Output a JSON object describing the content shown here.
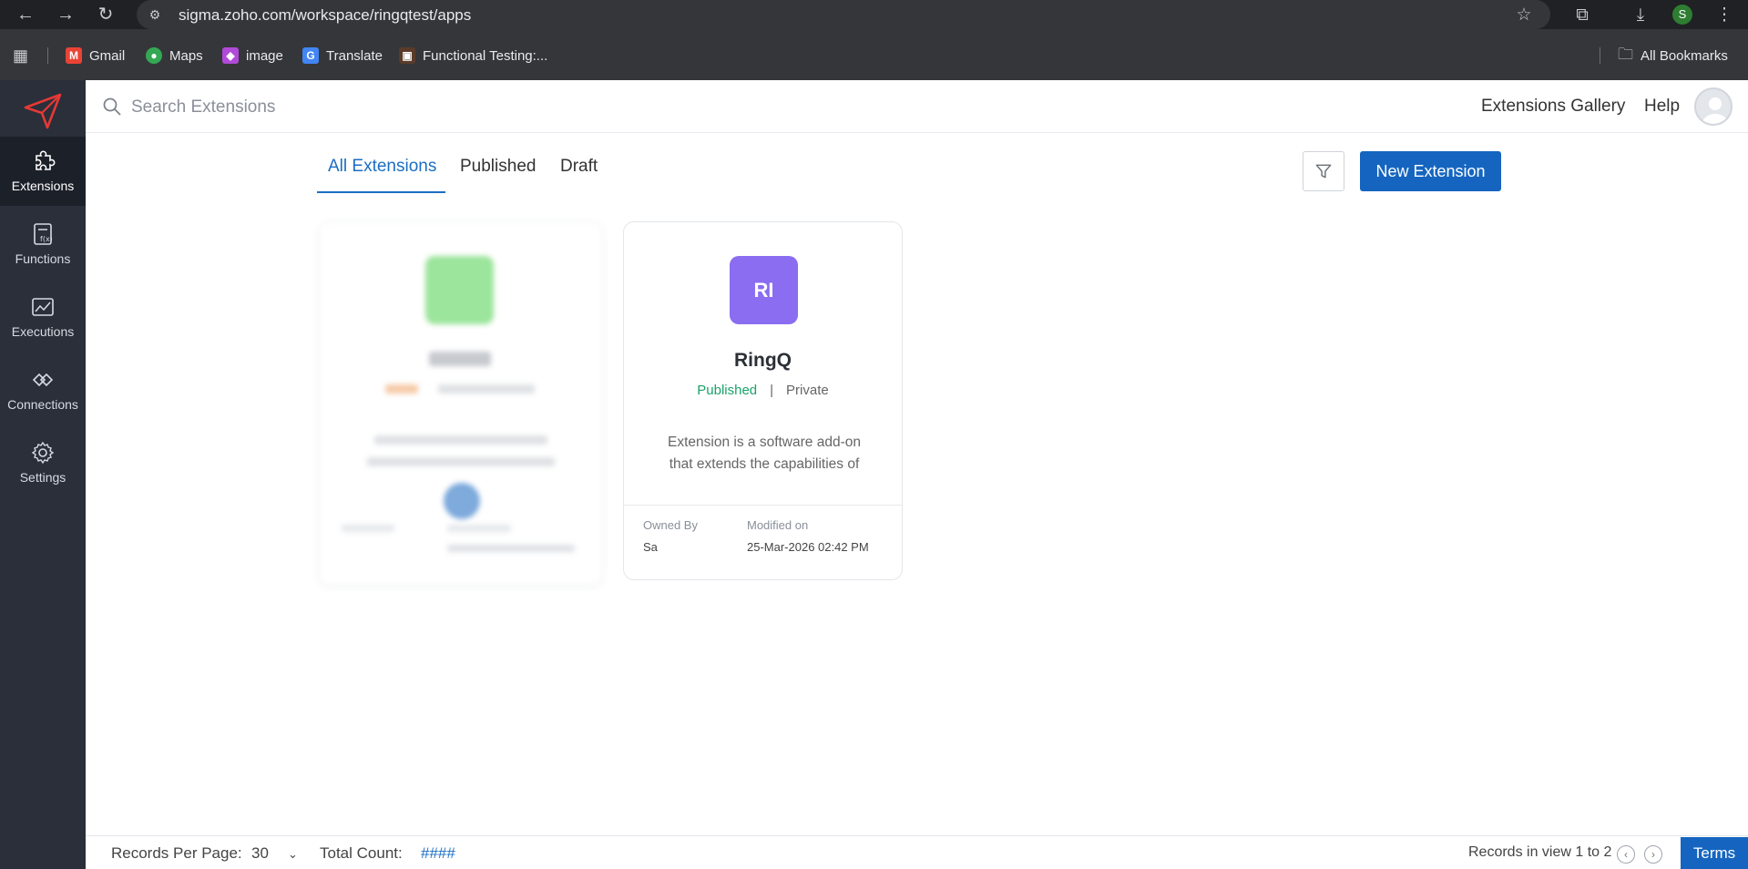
{
  "browser": {
    "url": "sigma.zoho.com/workspace/ringqtest/apps",
    "profile_initial": "S",
    "bookmarks": [
      {
        "label": "Gmail"
      },
      {
        "label": "Maps"
      },
      {
        "label": "image"
      },
      {
        "label": "Translate"
      },
      {
        "label": "Functional Testing:..."
      }
    ],
    "all_bookmarks": "All Bookmarks"
  },
  "sidebar": {
    "items": [
      {
        "label": "Extensions",
        "icon": "puzzle-icon"
      },
      {
        "label": "Functions",
        "icon": "function-icon"
      },
      {
        "label": "Executions",
        "icon": "executions-icon"
      },
      {
        "label": "Connections",
        "icon": "connections-icon"
      },
      {
        "label": "Settings",
        "icon": "gear-icon"
      }
    ]
  },
  "header": {
    "search_placeholder": "Search Extensions",
    "gallery_label": "Extensions Gallery",
    "help_label": "Help"
  },
  "tabs": [
    {
      "label": "All Extensions"
    },
    {
      "label": "Published"
    },
    {
      "label": "Draft"
    }
  ],
  "actions": {
    "new_extension": "New Extension"
  },
  "cards": [
    {
      "initials": "RI",
      "name": "RingQ",
      "status": "Published",
      "visibility": "Private",
      "description": "Extension is a software add-on that extends the capabilities of",
      "owned_by_label": "Owned By",
      "owned_by": "Sa",
      "modified_label": "Modified on",
      "modified": "25-Mar-2026 02:42 PM",
      "avatar_color": "#8a6df0"
    }
  ],
  "footer": {
    "records_per_page_label": "Records Per Page:",
    "records_per_page": "30",
    "total_count_label": "Total Count:",
    "total_count": "####",
    "records_in_view": "Records in view 1 to 2",
    "terms": "Terms"
  },
  "colors": {
    "accent": "#1565c0",
    "sidebar_bg": "#2a2f3a",
    "published": "#1aa36b"
  }
}
